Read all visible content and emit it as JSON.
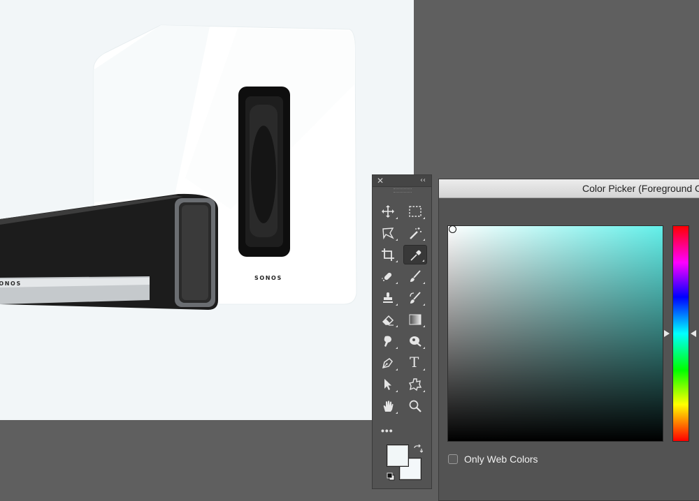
{
  "canvas": {
    "subwoofer_brand": "SONOS",
    "soundbar_brand": "SONOS"
  },
  "toolbox": {
    "close_glyph": "✕",
    "collapse_glyph": "‹‹",
    "more_glyph": "•••",
    "tools": [
      {
        "name": "move-icon",
        "active": false
      },
      {
        "name": "marquee-icon",
        "active": false
      },
      {
        "name": "lasso-icon",
        "active": false
      },
      {
        "name": "magic-wand-icon",
        "active": false
      },
      {
        "name": "crop-icon",
        "active": false
      },
      {
        "name": "eyedropper-icon",
        "active": true
      },
      {
        "name": "healing-brush-icon",
        "active": false
      },
      {
        "name": "brush-icon",
        "active": false
      },
      {
        "name": "clone-stamp-icon",
        "active": false
      },
      {
        "name": "history-brush-icon",
        "active": false
      },
      {
        "name": "eraser-icon",
        "active": false
      },
      {
        "name": "gradient-icon",
        "active": false
      },
      {
        "name": "smudge-icon",
        "active": false
      },
      {
        "name": "dodge-icon",
        "active": false
      },
      {
        "name": "pen-icon",
        "active": false
      },
      {
        "name": "type-icon",
        "active": false
      },
      {
        "name": "path-selection-icon",
        "active": false
      },
      {
        "name": "custom-shape-icon",
        "active": false
      },
      {
        "name": "hand-icon",
        "active": false
      },
      {
        "name": "zoom-icon",
        "active": false
      }
    ],
    "type_glyph": "T",
    "foreground_color": "#f2f7f8",
    "background_color": "#f4f8fa"
  },
  "color_picker": {
    "title": "Color Picker (Foreground Color)",
    "field_hue_color": "#63f0ea",
    "only_web_colors_label": "Only Web Colors",
    "only_web_colors_checked": false
  }
}
